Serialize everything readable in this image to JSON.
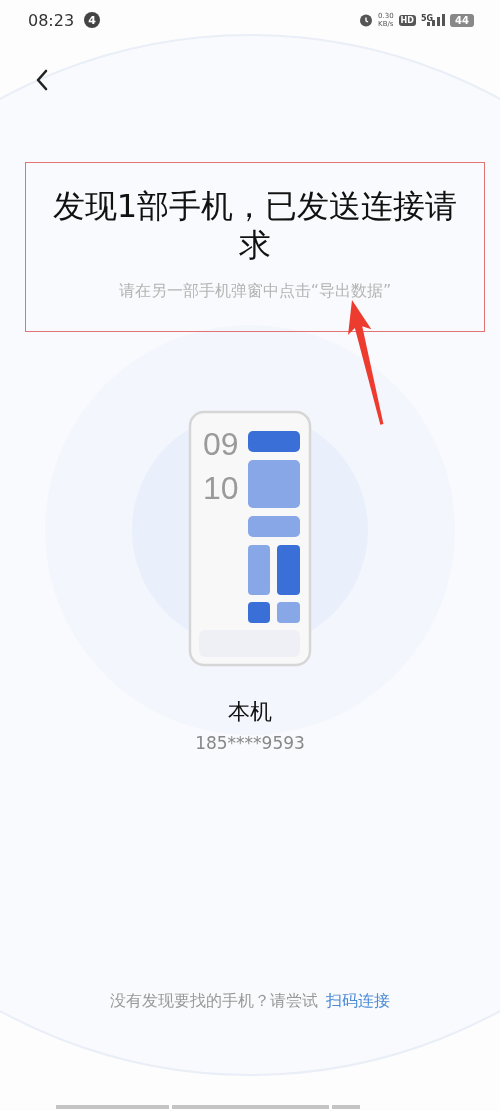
{
  "status_bar": {
    "time": "08:23",
    "notification_count": "4",
    "net_speed": "0.30",
    "net_unit": "KB/s",
    "hd": "HD",
    "network": "5G",
    "battery": "44"
  },
  "title": "发现1部手机，已发送连接请求",
  "subtitle": "请在另一部手机弹窗中点击“导出数据”",
  "phone_illustration": {
    "clock_hours": "09",
    "clock_minutes": "10"
  },
  "device": {
    "name": "本机",
    "number": "185****9593"
  },
  "footer": {
    "prompt": "没有发现要找的手机？请尝试",
    "link": "扫码连接"
  }
}
